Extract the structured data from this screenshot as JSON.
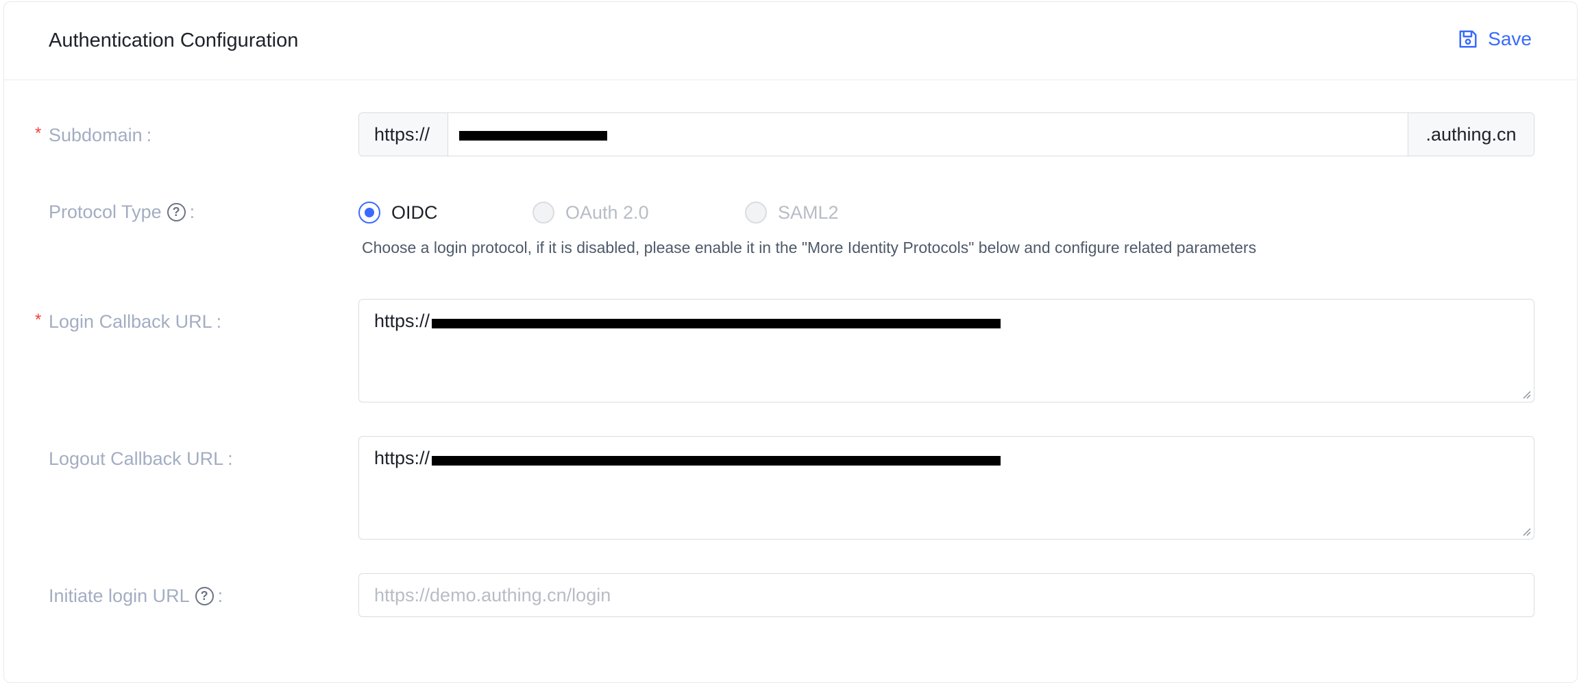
{
  "header": {
    "title": "Authentication Configuration",
    "save_label": "Save"
  },
  "fields": {
    "subdomain": {
      "label": "Subdomain",
      "required": "*",
      "prefix": "https://",
      "suffix": ".authing.cn"
    },
    "protocol": {
      "label": "Protocol Type",
      "options": [
        "OIDC",
        "OAuth 2.0",
        "SAML2"
      ],
      "selected": "OIDC",
      "help": "Choose a login protocol, if it is disabled, please enable it in the \"More Identity Protocols\" below and configure related parameters"
    },
    "login_callback": {
      "label": "Login Callback URL",
      "required": "*",
      "value_prefix": "https://"
    },
    "logout_callback": {
      "label": "Logout Callback URL",
      "value_prefix": "https://"
    },
    "initiate_login": {
      "label": "Initiate login URL",
      "placeholder": "https://demo.authing.cn/login"
    }
  },
  "colon": ":",
  "colors": {
    "accent": "#396aff",
    "required": "#f53f3f",
    "label": "#a3adc2"
  }
}
